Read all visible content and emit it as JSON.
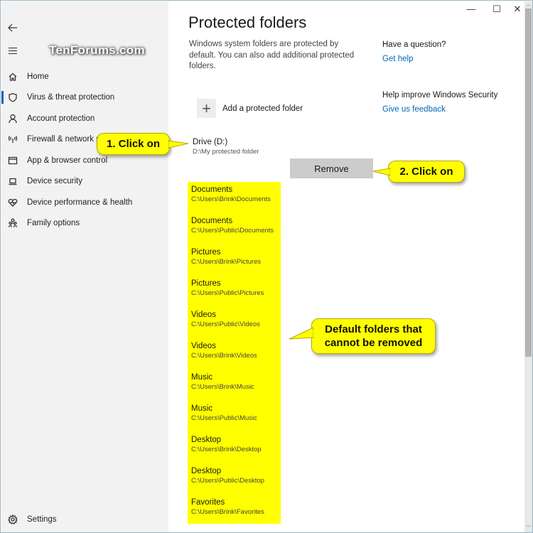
{
  "watermark": "TenForums.com",
  "sidebar": {
    "back_icon": "back-arrow-icon",
    "menu_icon": "hamburger-icon",
    "items": [
      {
        "label": "Home",
        "icon": "home-icon",
        "active": false
      },
      {
        "label": "Virus & threat protection",
        "icon": "shield-icon",
        "active": true
      },
      {
        "label": "Account protection",
        "icon": "person-icon",
        "active": false
      },
      {
        "label": "Firewall & network protection",
        "icon": "wifi-antenna-icon",
        "active": false
      },
      {
        "label": "App & browser control",
        "icon": "browser-window-icon",
        "active": false
      },
      {
        "label": "Device security",
        "icon": "laptop-icon",
        "active": false
      },
      {
        "label": "Device performance & health",
        "icon": "heart-pulse-icon",
        "active": false
      },
      {
        "label": "Family options",
        "icon": "family-icon",
        "active": false
      }
    ],
    "settings": {
      "label": "Settings",
      "icon": "gear-icon"
    }
  },
  "window_controls": {
    "minimize": "—",
    "maximize": "☐",
    "close": "✕"
  },
  "main": {
    "title": "Protected folders",
    "description": "Windows system folders are protected by default. You can also add additional protected folders.",
    "add_button_label": "Add a protected folder",
    "custom_folder": {
      "name": "Drive (D:)",
      "path": "D:\\My protected folder"
    },
    "remove_button_label": "Remove",
    "default_folders": [
      {
        "name": "Documents",
        "path": "C:\\Users\\Brink\\Documents"
      },
      {
        "name": "Documents",
        "path": "C:\\Users\\Public\\Documents"
      },
      {
        "name": "Pictures",
        "path": "C:\\Users\\Brink\\Pictures"
      },
      {
        "name": "Pictures",
        "path": "C:\\Users\\Public\\Pictures"
      },
      {
        "name": "Videos",
        "path": "C:\\Users\\Public\\Videos"
      },
      {
        "name": "Videos",
        "path": "C:\\Users\\Brink\\Videos"
      },
      {
        "name": "Music",
        "path": "C:\\Users\\Brink\\Music"
      },
      {
        "name": "Music",
        "path": "C:\\Users\\Public\\Music"
      },
      {
        "name": "Desktop",
        "path": "C:\\Users\\Brink\\Desktop"
      },
      {
        "name": "Desktop",
        "path": "C:\\Users\\Public\\Desktop"
      },
      {
        "name": "Favorites",
        "path": "C:\\Users\\Brink\\Favorites"
      }
    ]
  },
  "aside": {
    "question_heading": "Have a question?",
    "get_help_link": "Get help",
    "improve_heading": "Help improve Windows Security",
    "feedback_link": "Give us feedback"
  },
  "callouts": {
    "step1": "1. Click on",
    "step2": "2. Click on",
    "defaults_line1": "Default folders that",
    "defaults_line2": "cannot be removed"
  },
  "colors": {
    "highlight": "#ffff00",
    "link": "#0067b8",
    "accent": "#0063b1",
    "remove_button": "#cccccc"
  }
}
